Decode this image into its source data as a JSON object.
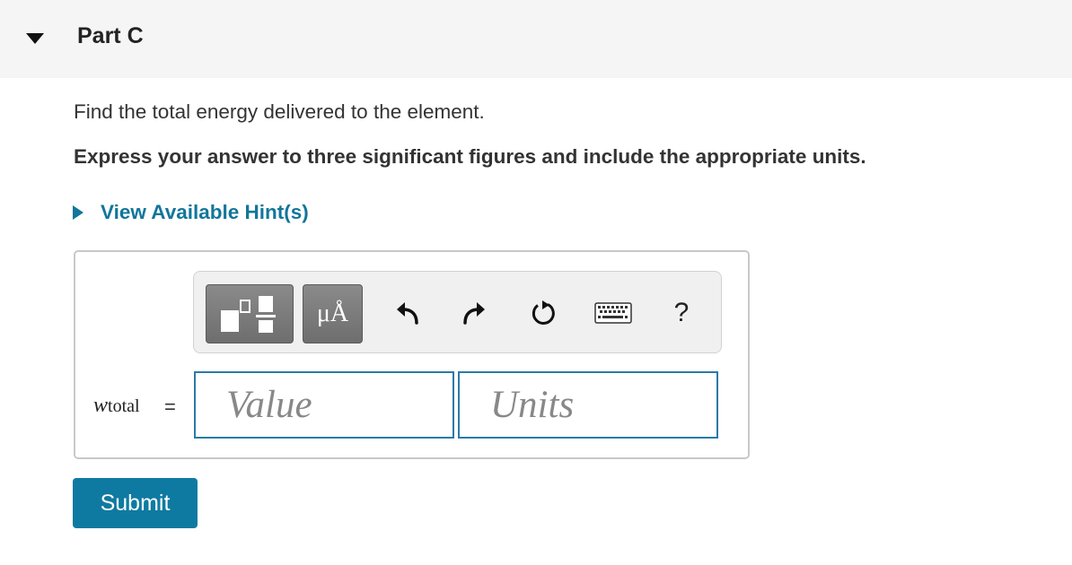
{
  "part": {
    "title": "Part C"
  },
  "question": {
    "prompt": "Find the total energy delivered to the element.",
    "instruction": "Express your answer to three significant figures and include the appropriate units."
  },
  "hint": {
    "label": "View Available Hint(s)"
  },
  "toolbar": {
    "units_glyph": "μÅ",
    "help_glyph": "?"
  },
  "answer": {
    "variable": "w",
    "variable_subscript": "total",
    "equals": "=",
    "value_placeholder": "Value",
    "units_placeholder": "Units"
  },
  "submit": {
    "label": "Submit"
  },
  "colors": {
    "link": "#12769a",
    "submit_bg": "#0f7aa1",
    "field_border": "#2b7aa8",
    "header_bg": "#f5f5f5"
  }
}
